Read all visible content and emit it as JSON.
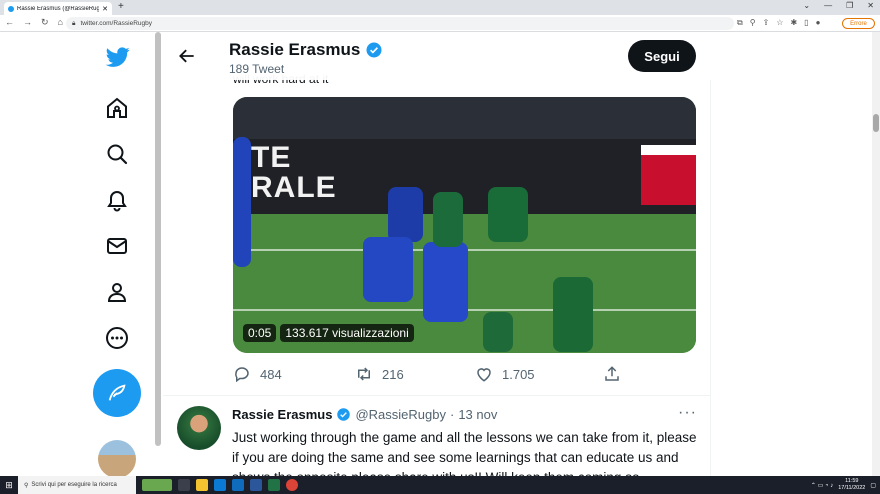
{
  "browser": {
    "tab_title": "Rassie Erasmus (@RassieRugby)",
    "url": "twitter.com/RassieRugby",
    "error_label": "Errore"
  },
  "profile_header": {
    "name": "Rassie Erasmus",
    "tweet_count": "189 Tweet",
    "follow_label": "Segui",
    "cut_text": "will work hard at it"
  },
  "video": {
    "banner_text_1": "TE",
    "banner_text_2": "RALE",
    "duration": "0:05",
    "views": "133.617 visualizzazioni"
  },
  "actions": {
    "replies": "484",
    "retweets": "216",
    "likes": "1.705"
  },
  "tweet2": {
    "name": "Rassie Erasmus",
    "handle": "@RassieRugby",
    "separator": "·",
    "date": "13 nov",
    "more": "···",
    "text": "Just working through the game and all the lessons we can take from it, please if you are doing the same and see some learnings that can educate us and shows the opposite please share with us!! Will keep them coming so"
  },
  "taskbar": {
    "search_placeholder": "Scrivi qui per eseguire la ricerca",
    "time": "11:59",
    "date": "17/11/2022"
  },
  "colors": {
    "twitter_blue": "#1d9bf0",
    "follow_bg": "#0f1419"
  },
  "icons": [
    "twitter-logo-icon",
    "home-icon",
    "explore-icon",
    "notifications-icon",
    "messages-icon",
    "profile-icon",
    "more-icon",
    "compose-icon",
    "back-arrow-icon",
    "verified-icon",
    "reply-icon",
    "retweet-icon",
    "like-icon",
    "share-icon"
  ]
}
